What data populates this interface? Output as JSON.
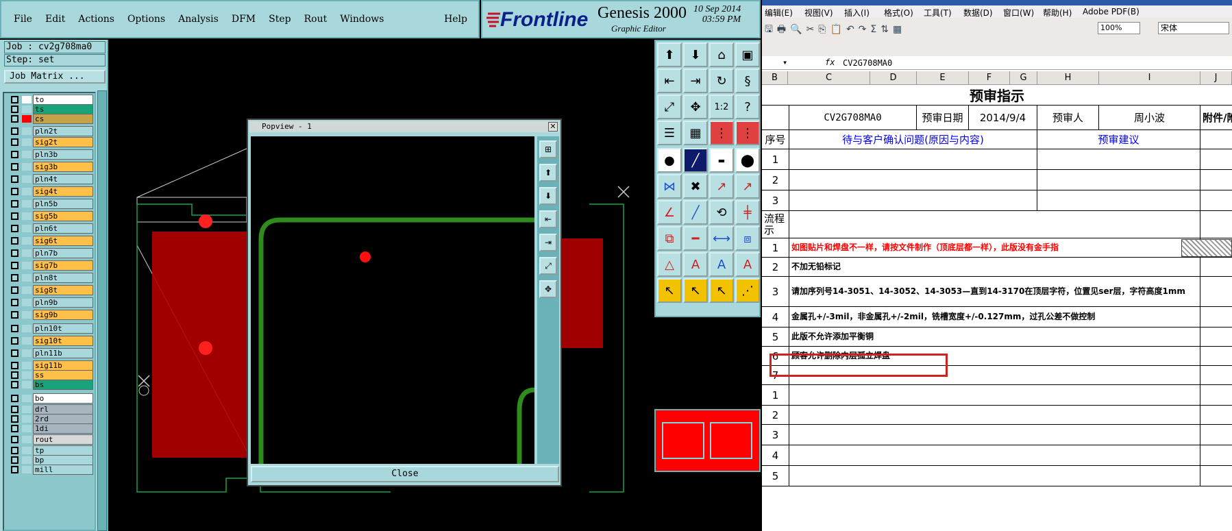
{
  "genesis": {
    "menu": [
      "File",
      "Edit",
      "Actions",
      "Options",
      "Analysis",
      "DFM",
      "Step",
      "Rout",
      "Windows"
    ],
    "help": "Help",
    "brand": "Frontline",
    "product": "Genesis 2000",
    "subtitle": "Graphic Editor",
    "date": "10 Sep 2014",
    "time": "03:59 PM",
    "job": "Job : cv2g708ma0",
    "step": "Step: set",
    "job_matrix": "Job Matrix ...",
    "layers": [
      {
        "name": "to",
        "color": "#ffffff",
        "sw": "#ffffff"
      },
      {
        "name": "ts",
        "color": "#1aa37a",
        "sw": "#a8d8dc"
      },
      {
        "name": "cs",
        "color": "#c4a24a",
        "sw": "#ff0000"
      },
      {
        "name": "pln2t",
        "color": "#a8d8dc",
        "sw": "#a8d8dc"
      },
      {
        "name": "sig2t",
        "color": "#ffc04a",
        "sw": "#a8d8dc"
      },
      {
        "name": "pln3b",
        "color": "#a8d8dc",
        "sw": "#a8d8dc"
      },
      {
        "name": "sig3b",
        "color": "#ffc04a",
        "sw": "#a8d8dc"
      },
      {
        "name": "pln4t",
        "color": "#a8d8dc",
        "sw": "#a8d8dc"
      },
      {
        "name": "sig4t",
        "color": "#ffc04a",
        "sw": "#a8d8dc"
      },
      {
        "name": "pln5b",
        "color": "#a8d8dc",
        "sw": "#a8d8dc"
      },
      {
        "name": "sig5b",
        "color": "#ffc04a",
        "sw": "#a8d8dc"
      },
      {
        "name": "pln6t",
        "color": "#a8d8dc",
        "sw": "#a8d8dc"
      },
      {
        "name": "sig6t",
        "color": "#ffc04a",
        "sw": "#a8d8dc"
      },
      {
        "name": "pln7b",
        "color": "#a8d8dc",
        "sw": "#a8d8dc"
      },
      {
        "name": "sig7b",
        "color": "#ffc04a",
        "sw": "#a8d8dc"
      },
      {
        "name": "pln8t",
        "color": "#a8d8dc",
        "sw": "#a8d8dc"
      },
      {
        "name": "sig8t",
        "color": "#ffc04a",
        "sw": "#a8d8dc"
      },
      {
        "name": "pln9b",
        "color": "#a8d8dc",
        "sw": "#a8d8dc"
      },
      {
        "name": "sig9b",
        "color": "#ffc04a",
        "sw": "#a8d8dc"
      },
      {
        "name": "pln10t",
        "color": "#a8d8dc",
        "sw": "#a8d8dc"
      },
      {
        "name": "sig10t",
        "color": "#ffc04a",
        "sw": "#a8d8dc"
      },
      {
        "name": "pln11b",
        "color": "#a8d8dc",
        "sw": "#a8d8dc"
      },
      {
        "name": "sig11b",
        "color": "#ffc04a",
        "sw": "#a8d8dc"
      },
      {
        "name": "ss",
        "color": "#ffc04a",
        "sw": "#a8d8dc"
      },
      {
        "name": "bs",
        "color": "#1aa37a",
        "sw": "#a8d8dc"
      },
      {
        "name": "bo",
        "color": "#ffffff",
        "sw": "#a8d8dc"
      },
      {
        "name": "drl",
        "color": "#a7b5c0",
        "sw": "#a8d8dc"
      },
      {
        "name": "2rd",
        "color": "#a7b5c0",
        "sw": "#a8d8dc"
      },
      {
        "name": "1di",
        "color": "#a7b5c0",
        "sw": "#a8d8dc"
      },
      {
        "name": "rout",
        "color": "#d8d8d8",
        "sw": "#a8d8dc"
      },
      {
        "name": "tp",
        "color": "#a8d8dc",
        "sw": "#a8d8dc"
      },
      {
        "name": "bp",
        "color": "#a8d8dc",
        "sw": "#a8d8dc"
      },
      {
        "name": "mill",
        "color": "#a8d8dc",
        "sw": "#a8d8dc"
      }
    ],
    "popview": {
      "title": "Popview - 1",
      "close": "Close"
    }
  },
  "excel": {
    "menu": [
      "编辑(E)",
      "视图(V)",
      "插入(I)",
      "格式(O)",
      "工具(T)",
      "数据(D)",
      "窗口(W)",
      "帮助(H)",
      "Adobe PDF(B)"
    ],
    "zoom": "100%",
    "font": "宋体",
    "formula": "CV2G708MA0",
    "columns": [
      "B",
      "C",
      "D",
      "E",
      "F",
      "G",
      "H",
      "I",
      "J"
    ],
    "title": "预审指示",
    "header": {
      "job": "CV2G708MA0",
      "date_label": "预审日期",
      "date": "2014/9/4",
      "person_label": "预审人",
      "person": "周小波",
      "attach": "附件/附图"
    },
    "col_header": {
      "num": "序号",
      "issue": "待与客户确认问题(原因与内容)",
      "suggest": "预审建议"
    },
    "flow_label": "流程\n示",
    "q_rows": [
      "1",
      "2",
      "3"
    ],
    "items": [
      {
        "n": "1",
        "t": "如图贴片和焊盘不一样，请按文件制作（顶底层都一样），此版没有金手指",
        "red": true
      },
      {
        "n": "2",
        "t": "不加无铅标记",
        "red": false
      },
      {
        "n": "3",
        "t": "请加序列号14-3051、14-3052、14-3053—直到14-3170在顶层字符，位置见ser层，字符高度1mm",
        "red": false
      },
      {
        "n": "4",
        "t": "金属孔+/-3mil，非金属孔+/-2mil，铣槽宽度+/-0.127mm，过孔公差不做控制",
        "red": false
      },
      {
        "n": "5",
        "t": "此版不允许添加平衡铜",
        "red": false
      },
      {
        "n": "6",
        "t": "顾客允许删除内层孤立焊盘",
        "red": false
      },
      {
        "n": "7",
        "t": "",
        "red": false
      },
      {
        "n": "1",
        "t": "",
        "red": false
      },
      {
        "n": "2",
        "t": "",
        "red": false
      },
      {
        "n": "3",
        "t": "",
        "red": false
      },
      {
        "n": "4",
        "t": "",
        "red": false
      },
      {
        "n": "5",
        "t": "",
        "red": false
      }
    ]
  }
}
